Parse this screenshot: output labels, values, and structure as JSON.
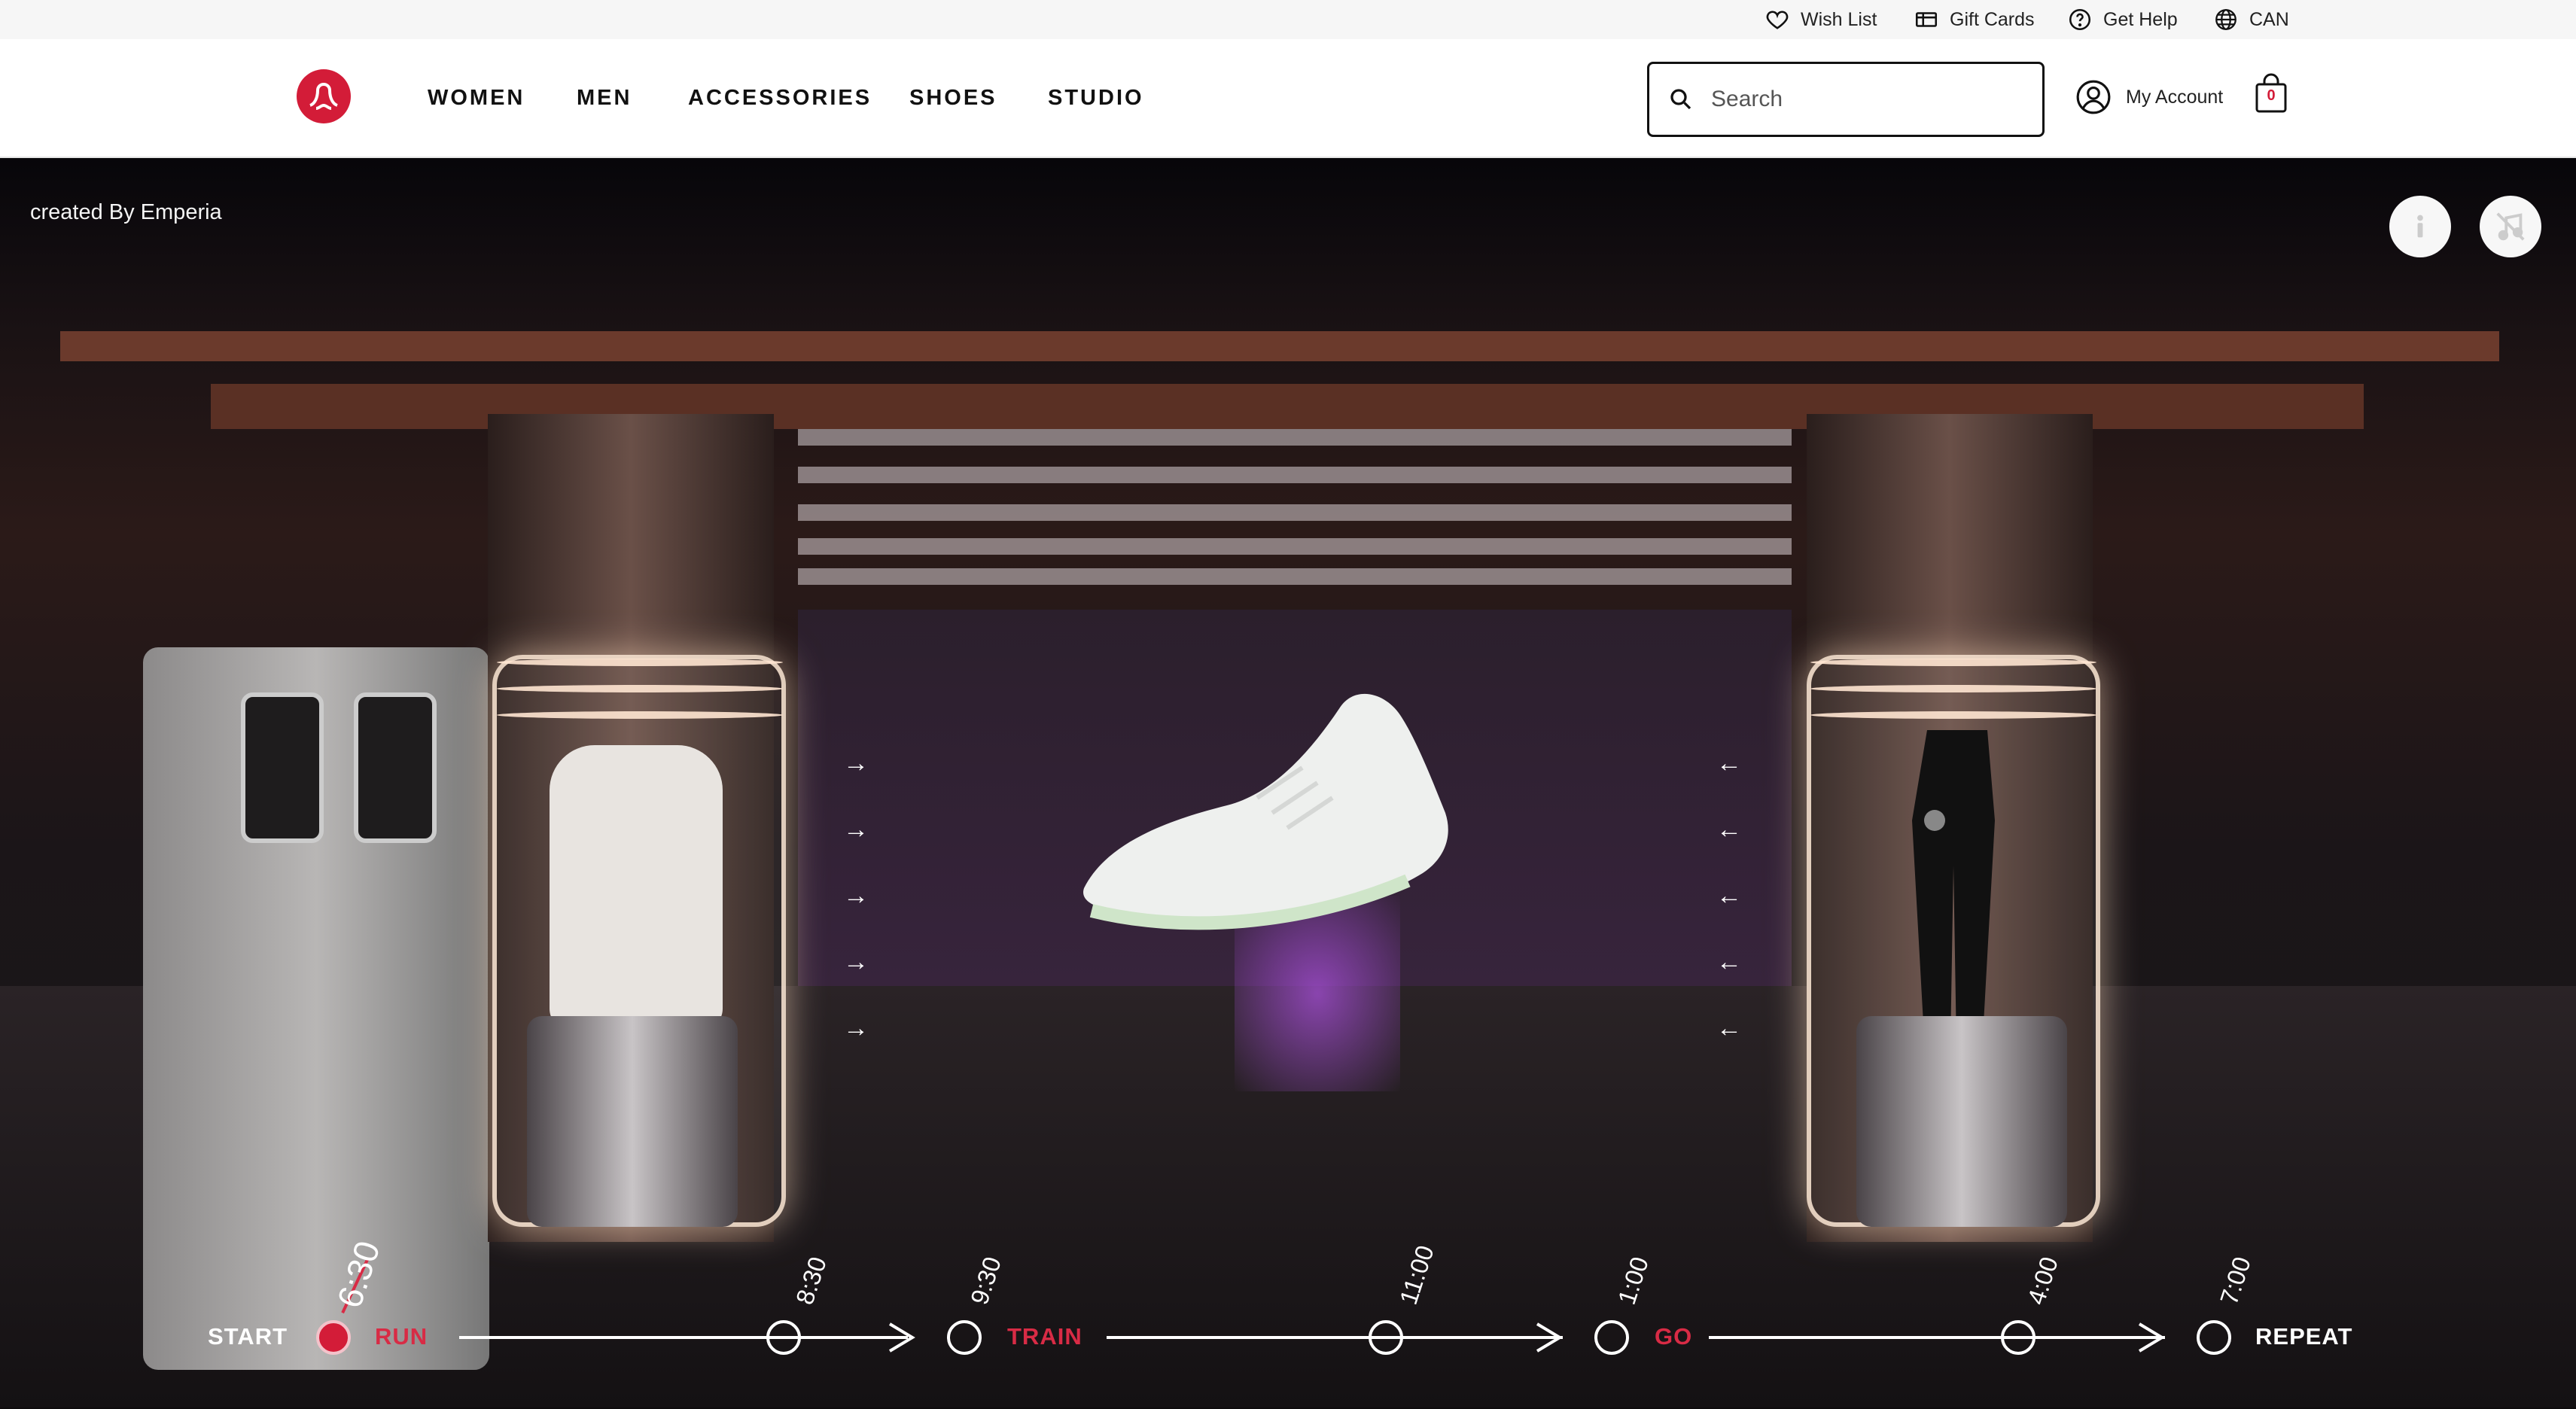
{
  "utility_bar": {
    "wish_list": "Wish List",
    "gift_cards": "Gift Cards",
    "get_help": "Get Help",
    "region": "CAN"
  },
  "header": {
    "nav": [
      "WOMEN",
      "MEN",
      "ACCESSORIES",
      "SHOES",
      "STUDIO"
    ],
    "search_placeholder": "Search",
    "account_label": "My Account",
    "bag_count": "0"
  },
  "hero": {
    "credit": "created By Emperia",
    "info_button": "info-icon",
    "sound_button": "sound-muted-icon"
  },
  "timeline": {
    "stages": [
      "START",
      "RUN",
      "TRAIN",
      "GO",
      "REPEAT"
    ],
    "times": [
      "6:30",
      "8:30",
      "9:30",
      "11:00",
      "1:00",
      "4:00",
      "7:00"
    ]
  },
  "colors": {
    "brand_red": "#d31c38",
    "stage_red": "#d82b45"
  }
}
